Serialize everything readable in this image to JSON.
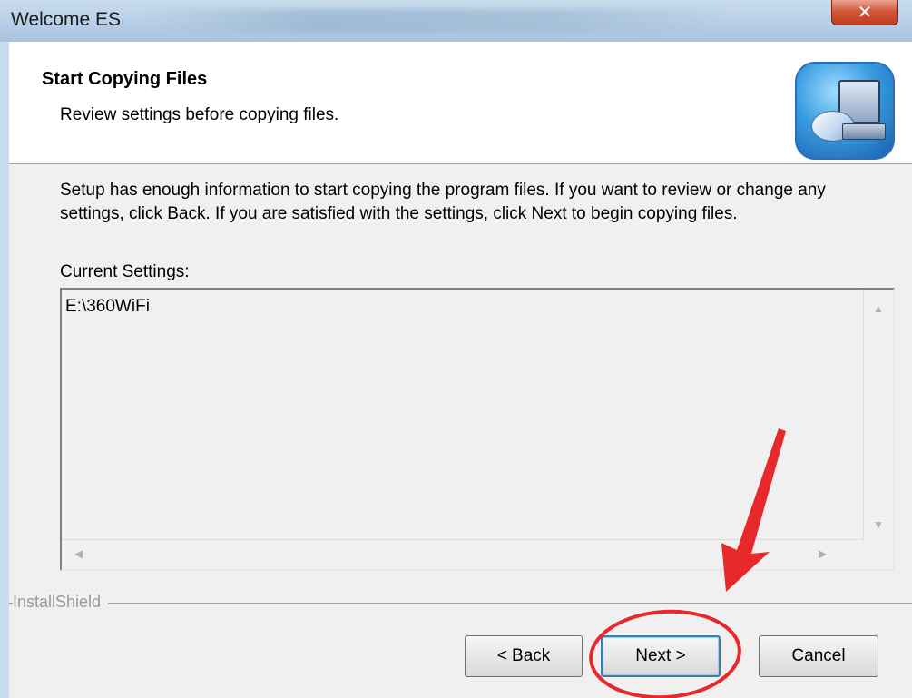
{
  "window": {
    "title": "Welcome ES",
    "close_icon": "close-icon"
  },
  "header": {
    "heading": "Start Copying Files",
    "subheading": "Review settings before copying files.",
    "logo_icon": "installer-computer-icon"
  },
  "body": {
    "description": "Setup has enough information to start copying the program files.  If you want to review or change any settings, click Back.  If you are satisfied with the settings, click Next to begin copying files.",
    "current_settings_label": "Current Settings:",
    "current_settings_value": "E:\\360WiFi"
  },
  "footer": {
    "brand": "InstallShield",
    "back_label": "< Back",
    "next_label": "Next >",
    "cancel_label": "Cancel"
  },
  "colors": {
    "annotation": "#e8292b",
    "title_bar": "#b7cfe7",
    "close_button": "#c94a2f"
  }
}
